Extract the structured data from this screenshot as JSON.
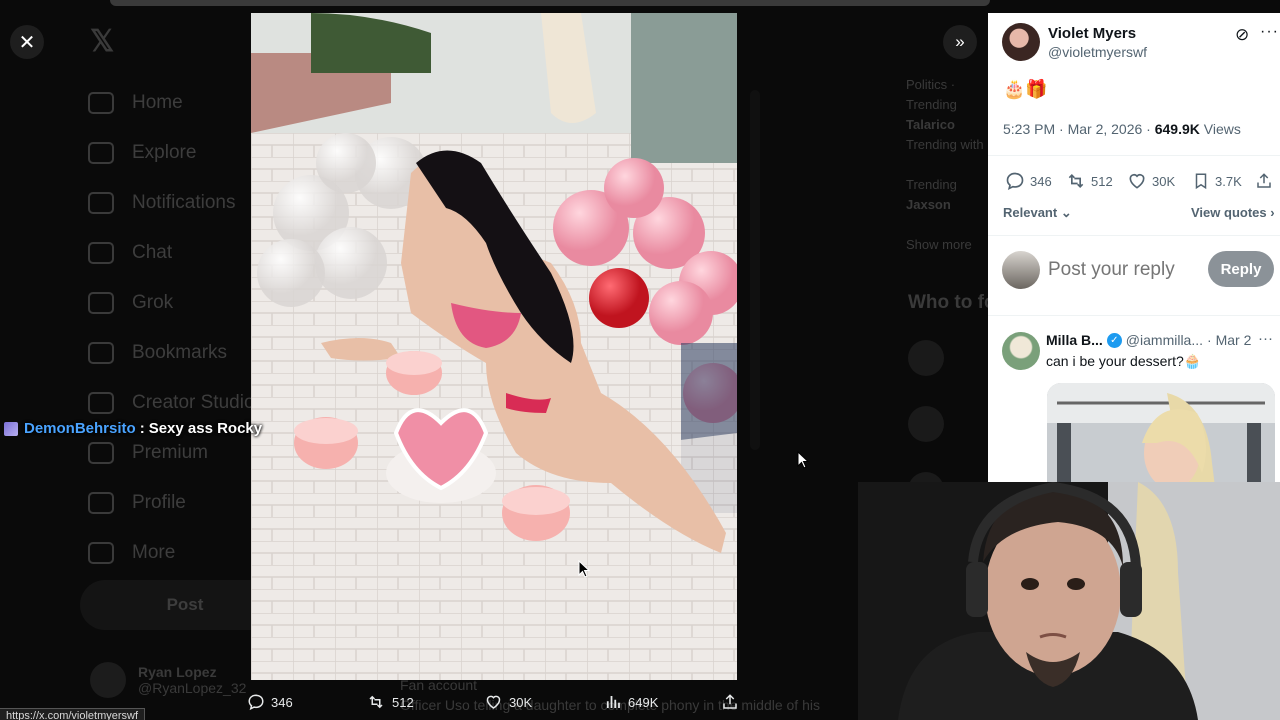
{
  "background": {
    "nav": [
      "Home",
      "Explore",
      "Notifications",
      "Chat",
      "Grok",
      "Bookmarks",
      "Creator Studio",
      "Premium",
      "Profile",
      "More"
    ],
    "post_button": "Post",
    "account_name": "Ryan Lopez",
    "account_handle": "@RyanLopez_32",
    "right_trend_category": "Politics · Trending",
    "right_trend_name": "Talarico",
    "right_trend_sub": "Trending with",
    "right_trend2_category": "Trending",
    "right_trend2_name": "Jaxson",
    "right_show_more": "Show more",
    "right_who": "Who to follow",
    "bg_tweet_label": "Fan account",
    "bg_tweet_text": "Officer Uso telling a daughter to complete phony in the middle of his"
  },
  "viewer": {
    "close_icon": "close-icon",
    "expand_icon": "double-chevron-right-icon",
    "actions": {
      "replies": "346",
      "reposts": "512",
      "likes": "30K",
      "views": "649K"
    }
  },
  "status_url": "https://x.com/violetmyerswf",
  "chat": {
    "user": "DemonBehrsito",
    "separator": ":",
    "message": "Sexy ass Rocky"
  },
  "tweet": {
    "author_name": "Violet Myers",
    "author_handle": "@violetmyerswf",
    "text": "🎂🎁",
    "time": "5:23 PM · Mar 2, 2026 · ",
    "views_count": "649.9K",
    "views_label": " Views",
    "stats": {
      "replies": "346",
      "reposts": "512",
      "likes": "30K",
      "bookmarks": "3.7K"
    },
    "sort_label": "Relevant",
    "view_quotes": "View quotes",
    "reply_placeholder": "Post your reply",
    "reply_button": "Reply"
  },
  "reply": {
    "name": "Milla B...",
    "handle": "@iammilla...",
    "date": "· Mar 2",
    "text": "can i be your dessert?🧁"
  },
  "colors": {
    "accent": "#1d9bf0",
    "chat_user": "#4aa3ff",
    "reply_button_bg": "#8b9298"
  }
}
